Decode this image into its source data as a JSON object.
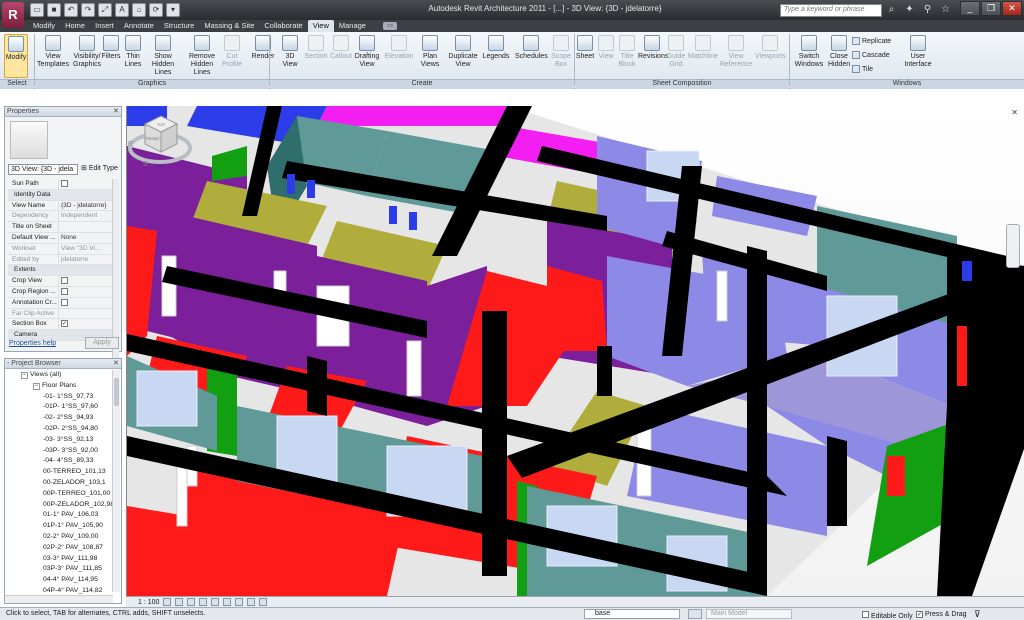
{
  "app": {
    "title": "Autodesk Revit Architecture 2011 - [...] - 3D View: {3D - jdelatorre}",
    "app_button": "R"
  },
  "qat": [
    "open",
    "save",
    "undo",
    "redo",
    "measure",
    "text",
    "3d",
    "sync",
    "close-views"
  ],
  "search": {
    "placeholder": "Type a keyword or phrase"
  },
  "tabs": [
    "Modify",
    "Home",
    "Insert",
    "Annotate",
    "Structure",
    "Massing & Site",
    "Collaborate",
    "View",
    "Manage"
  ],
  "active_tab": "View",
  "ribbon": {
    "buttons": [
      {
        "label": "Modify",
        "icon": "cursor-icon"
      },
      {
        "label": "View\nTemplates",
        "icon": "view-templates-icon"
      },
      {
        "label": "Visibility/\nGraphics",
        "icon": "visibility-icon"
      },
      {
        "label": "Filters",
        "icon": "filters-icon"
      },
      {
        "label": "Thin\nLines",
        "icon": "thin-lines-icon"
      },
      {
        "label": "Show\nHidden Lines",
        "icon": "show-hidden-icon"
      },
      {
        "label": "Remove\nHidden Lines",
        "icon": "remove-hidden-icon"
      },
      {
        "label": "Cut\nProfile",
        "icon": "cut-profile-icon"
      },
      {
        "label": "Render",
        "icon": "teapot-icon"
      },
      {
        "label": "3D\nView",
        "icon": "3d-view-icon"
      },
      {
        "label": "Section",
        "icon": "section-icon"
      },
      {
        "label": "Callout",
        "icon": "callout-icon"
      },
      {
        "label": "Drafting\nView",
        "icon": "drafting-icon"
      },
      {
        "label": "Elevation",
        "icon": "elevation-icon"
      },
      {
        "label": "Plan\nViews",
        "icon": "plan-views-icon"
      },
      {
        "label": "Duplicate\nView",
        "icon": "duplicate-icon"
      },
      {
        "label": "Legends",
        "icon": "legends-icon"
      },
      {
        "label": "Schedules",
        "icon": "schedules-icon"
      },
      {
        "label": "Scope\nBox",
        "icon": "scope-box-icon"
      },
      {
        "label": "Sheet",
        "icon": "sheet-icon"
      },
      {
        "label": "View",
        "icon": "view-icon"
      },
      {
        "label": "Title\nBlock",
        "icon": "title-block-icon"
      },
      {
        "label": "Revisions",
        "icon": "revisions-icon"
      },
      {
        "label": "Guide\nGrid",
        "icon": "guide-grid-icon"
      },
      {
        "label": "Matchline",
        "icon": "matchline-icon"
      },
      {
        "label": "View\nReference",
        "icon": "view-reference-icon"
      },
      {
        "label": "Viewports",
        "icon": "viewports-icon"
      },
      {
        "label": "Switch\nWindows",
        "icon": "switch-windows-icon"
      },
      {
        "label": "Close\nHidden",
        "icon": "close-hidden-icon"
      },
      {
        "label": "User\nInterface",
        "icon": "user-interface-icon"
      }
    ],
    "small": {
      "replicate": "Replicate",
      "cascade": "Cascade",
      "tile": "Tile"
    },
    "panels": {
      "select": "Select",
      "graphics": "Graphics",
      "create": "Create",
      "sheet": "Sheet Composition",
      "windows": "Windows"
    }
  },
  "properties": {
    "title": "Properties",
    "type": "3D View: {3D - jdela",
    "edit_type": "Edit Type",
    "rows": [
      {
        "k": "Sun Path",
        "v": "",
        "cb": false,
        "grp": false
      },
      {
        "k": "Identity Data",
        "v": "",
        "grp": true
      },
      {
        "k": "View Name",
        "v": "{3D - jdelatorre}"
      },
      {
        "k": "Dependency",
        "v": "Independent",
        "dis": true
      },
      {
        "k": "Title on Sheet",
        "v": ""
      },
      {
        "k": "Default View ...",
        "v": "None"
      },
      {
        "k": "Workset",
        "v": "View \"3D Vi...",
        "dis": true
      },
      {
        "k": "Edited by",
        "v": "jdelatorre",
        "dis": true
      },
      {
        "k": "Extents",
        "v": "",
        "grp": true
      },
      {
        "k": "Crop View",
        "v": "",
        "cb": false
      },
      {
        "k": "Crop Region ...",
        "v": "",
        "cb": false
      },
      {
        "k": "Annotation Cr...",
        "v": "",
        "cb": false
      },
      {
        "k": "Far Clip Active",
        "v": "",
        "dis": true
      },
      {
        "k": "Section Box",
        "v": "",
        "cb": true
      },
      {
        "k": "Camera",
        "v": "",
        "grp": true
      }
    ],
    "help": "Properties help",
    "apply": "Apply"
  },
  "browser": {
    "title": "Project Browser",
    "root": "Views (all)",
    "group": "Floor Plans",
    "items": [
      "-01- 1°SS_97,73",
      "-01P- 1°SS_97,60",
      "-02- 2°SS_94,93",
      "-02P- 2°SS_94,80",
      "-03- 3°SS_92,13",
      "-03P- 3°SS_92,00",
      "-04- 4°SS_89,33",
      "00-TERREO_101,13",
      "00-ZELADOR_103,1",
      "00P-TERREO_101,00",
      "00P-ZELADOR_102,98",
      "01-1° PAV_106,03",
      "01P-1° PAV_105,90",
      "02-2° PAV_109,00",
      "02P-2° PAV_108,87",
      "03-3° PAV_111,98",
      "03P-3° PAV_111,85",
      "04-4° PAV_114,95",
      "04P-4° PAV_114,82"
    ]
  },
  "viewport": {
    "scale": "1 : 100",
    "viewcube": {
      "top": "TOP",
      "front": "FRONT",
      "compass_s": "S",
      "compass_e": "E"
    }
  },
  "status": {
    "text": "Click to select, TAB for alternates, CTRL adds, SHIFT unselects.",
    "workset": "base",
    "model": "Main Model",
    "editable_only": "Editable Only",
    "press_drag": "Press & Drag"
  },
  "colors": {
    "purple": "#7b1f9a",
    "violet": "#8d89e6",
    "red": "#ff1a1a",
    "olive": "#b0ad3c",
    "teal": "#5f9a98",
    "magenta": "#f21ef2",
    "green": "#12a012",
    "blue": "#2b3ce8",
    "black": "#000000"
  }
}
